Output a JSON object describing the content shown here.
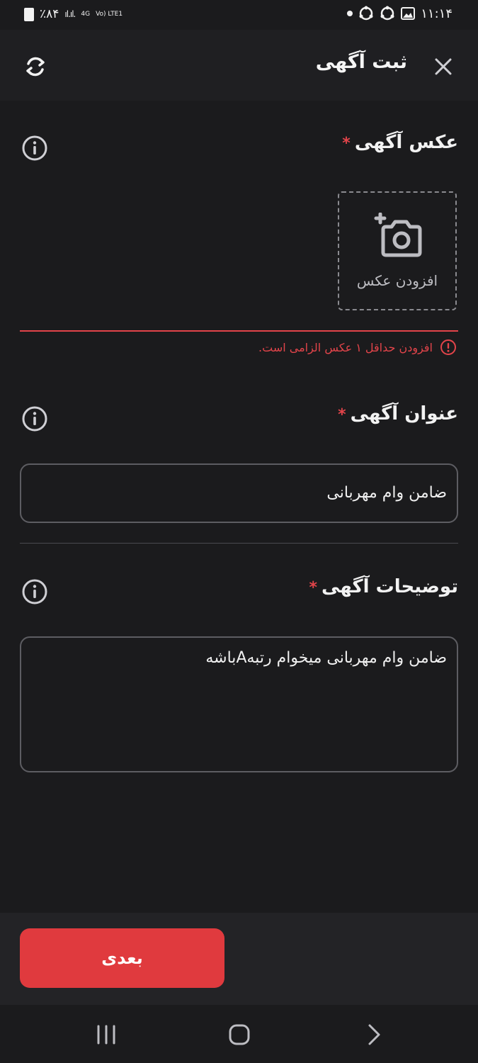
{
  "status_bar": {
    "battery": "٪۸۴",
    "network_top": "4G",
    "network_bottom": "Vo) LTE1",
    "time": "۱۱:۱۴"
  },
  "header": {
    "title": "ثبت آگهی",
    "close_icon": "close-icon",
    "refresh_icon": "refresh-icon"
  },
  "photo_section": {
    "title": "عکس آگهی",
    "required_mark": "*",
    "add_photo_label": "افزودن عکس",
    "error_message": "افزودن حداقل ۱ عکس الزامی است."
  },
  "title_section": {
    "title": "عنوان آگهی",
    "required_mark": "*",
    "value": "ضامن وام مهربانی"
  },
  "description_section": {
    "title": "توضیحات آگهی",
    "required_mark": "*",
    "value": "ضامن وام مهربانی میخوام رتبهAباشه"
  },
  "footer": {
    "next_label": "بعدی"
  },
  "colors": {
    "accent": "#e03a3e",
    "error": "#e2444a",
    "background": "#1b1b1d"
  }
}
